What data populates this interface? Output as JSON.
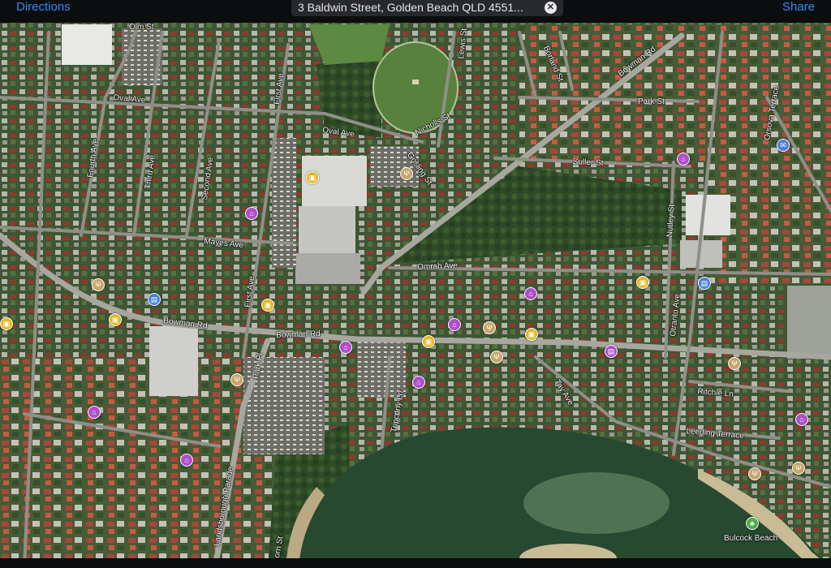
{
  "toolbar": {
    "directions_label": "Directions",
    "share_label": "Share",
    "search_value": "3 Baldwin Street, Golden Beach QLD 4551..."
  },
  "colors": {
    "bar_bg": "#0c0d0f",
    "link": "#2f8ef5",
    "poi_purple": "#b04fc9",
    "poi_yellow": "#e3b820",
    "poi_tan": "#c8a56a",
    "poi_blue": "#4a7fd6",
    "poi_green": "#4cae4c",
    "water": "#27492f",
    "sand": "#c9bb95"
  },
  "map": {
    "street_labels": [
      "Olm St",
      "Oval Ave",
      "Oval Ave",
      "Lewis St",
      "Borland St",
      "Bowman Rd",
      "Orsova Terrace",
      "Park St",
      "Nicholls St",
      "Gosling St",
      "Suller St",
      "First Ave",
      "Second Ave",
      "Third Ave",
      "Fourth Ave",
      "Mayes Ave",
      "Nutley St",
      "Omrah Ave",
      "Bowman Rd",
      "Bowman Rd",
      "Park Pl",
      "Otranto Ave",
      "Tay Ave",
      "Tripcony Ln",
      "Ritchie Ln",
      "Leeding Terrace",
      "Landsborough Parade",
      "Thorn St"
    ],
    "place_labels": [
      "Bulcock Beach"
    ],
    "pois": [
      {
        "icon": "bed-icon",
        "color": "purple"
      },
      {
        "icon": "bed-icon",
        "color": "purple"
      },
      {
        "icon": "bed-icon",
        "color": "purple"
      },
      {
        "icon": "bed-icon",
        "color": "purple"
      },
      {
        "icon": "bed-icon",
        "color": "purple"
      },
      {
        "icon": "bed-icon",
        "color": "purple"
      },
      {
        "icon": "bed-icon",
        "color": "purple"
      },
      {
        "icon": "bed-icon",
        "color": "purple"
      },
      {
        "icon": "bed-icon",
        "color": "purple"
      },
      {
        "icon": "shopping-bag-icon",
        "color": "yellow"
      },
      {
        "icon": "shopping-bag-icon",
        "color": "yellow"
      },
      {
        "icon": "shopping-bag-icon",
        "color": "yellow"
      },
      {
        "icon": "shopping-bag-icon",
        "color": "yellow"
      },
      {
        "icon": "shopping-bag-icon",
        "color": "yellow"
      },
      {
        "icon": "shopping-bag-icon",
        "color": "yellow"
      },
      {
        "icon": "shopping-bag-icon",
        "color": "yellow"
      },
      {
        "icon": "restaurant-icon",
        "color": "tan"
      },
      {
        "icon": "restaurant-icon",
        "color": "tan"
      },
      {
        "icon": "restaurant-icon",
        "color": "tan"
      },
      {
        "icon": "restaurant-icon",
        "color": "tan"
      },
      {
        "icon": "restaurant-icon",
        "color": "tan"
      },
      {
        "icon": "restaurant-icon",
        "color": "tan"
      },
      {
        "icon": "restaurant-icon",
        "color": "tan"
      },
      {
        "icon": "restaurant-icon",
        "color": "tan"
      },
      {
        "icon": "bank-icon",
        "color": "blue"
      },
      {
        "icon": "bank-icon",
        "color": "blue"
      },
      {
        "icon": "mail-icon",
        "color": "blue"
      },
      {
        "icon": "bank-icon",
        "color": "purple"
      },
      {
        "icon": "park-icon",
        "color": "green"
      }
    ]
  }
}
